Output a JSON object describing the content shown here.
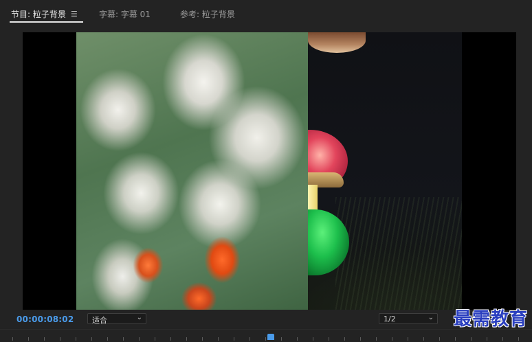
{
  "tabs": [
    {
      "label": "节目: 粒子背景",
      "active": true
    },
    {
      "label": "字幕: 字幕 01",
      "active": false
    },
    {
      "label": "参考: 粒子背景",
      "active": false
    }
  ],
  "controls": {
    "timecode": "00:00:08:02",
    "fit_select": "适合",
    "resolution_select": "1/2"
  },
  "watermark": "最需教育",
  "icons": {
    "panel_menu": "hamburger-icon",
    "dropdown": "chevron-down-icon"
  },
  "colors": {
    "accent": "#4a9bea",
    "background": "#232323",
    "viewer": "#000000"
  }
}
